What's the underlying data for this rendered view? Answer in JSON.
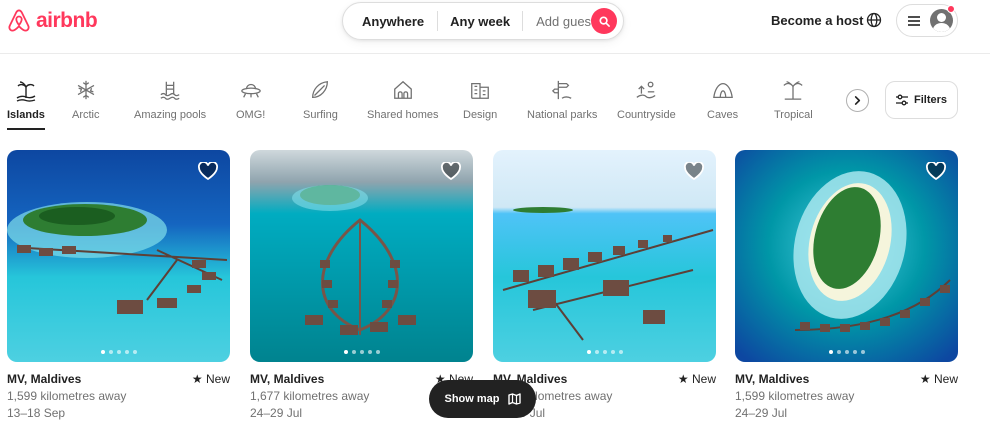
{
  "header": {
    "logo_text": "airbnb",
    "search": {
      "where": "Anywhere",
      "when": "Any week",
      "guests": "Add guests"
    },
    "become_host": "Become a host"
  },
  "categories": [
    {
      "label": "Islands",
      "icon": "island-icon",
      "active": true
    },
    {
      "label": "Arctic",
      "icon": "snowflake-icon"
    },
    {
      "label": "Amazing pools",
      "icon": "pool-icon"
    },
    {
      "label": "OMG!",
      "icon": "ufo-icon"
    },
    {
      "label": "Surfing",
      "icon": "surfboard-icon"
    },
    {
      "label": "Shared homes",
      "icon": "house-icon"
    },
    {
      "label": "Design",
      "icon": "building-icon"
    },
    {
      "label": "National parks",
      "icon": "signpost-icon"
    },
    {
      "label": "Countryside",
      "icon": "countryside-icon"
    },
    {
      "label": "Caves",
      "icon": "cave-icon"
    },
    {
      "label": "Tropical",
      "icon": "palm-icon"
    }
  ],
  "filters_label": "Filters",
  "listings": [
    {
      "location": "MV, Maldives",
      "rating": "New",
      "distance": "1,599 kilometres away",
      "dates": "13–18 Sep"
    },
    {
      "location": "MV, Maldives",
      "rating": "New",
      "distance": "1,677 kilometres away",
      "dates": "24–29 Jul"
    },
    {
      "location": "MV, Maldives",
      "rating": "New",
      "distance": "1,599 kilometres away",
      "dates": "24–29 Jul"
    },
    {
      "location": "MV, Maldives",
      "rating": "New",
      "distance": "1,599 kilometres away",
      "dates": "24–29 Jul"
    }
  ],
  "show_map_label": "Show map",
  "colors": {
    "brand": "#FF385C",
    "text": "#222222",
    "muted": "#717171"
  }
}
